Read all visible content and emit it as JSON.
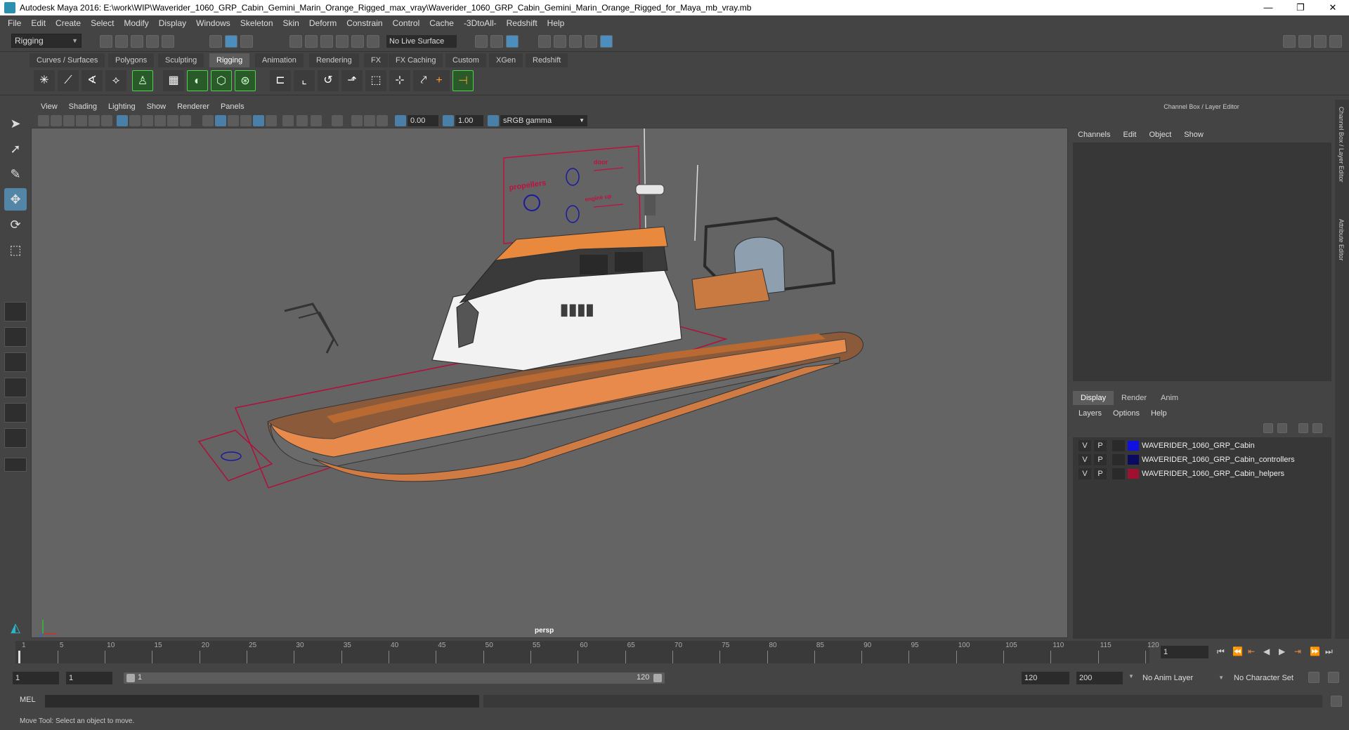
{
  "window": {
    "title": "Autodesk Maya 2016: E:\\work\\WIP\\Waverider_1060_GRP_Cabin_Gemini_Marin_Orange_Rigged_max_vray\\Waverider_1060_GRP_Cabin_Gemini_Marin_Orange_Rigged_for_Maya_mb_vray.mb",
    "minimize": "—",
    "restore": "❐",
    "close": "✕"
  },
  "menubar": [
    "File",
    "Edit",
    "Create",
    "Select",
    "Modify",
    "Display",
    "Windows",
    "Skeleton",
    "Skin",
    "Deform",
    "Constrain",
    "Control",
    "Cache",
    "-3DtoAll-",
    "Redshift",
    "Help"
  ],
  "statusline": {
    "mode": "Rigging",
    "live_surface": "No Live Surface"
  },
  "shelf_tabs": [
    "Curves / Surfaces",
    "Polygons",
    "Sculpting",
    "Rigging",
    "Animation",
    "Rendering",
    "FX",
    "FX Caching",
    "Custom",
    "XGen",
    "Redshift"
  ],
  "shelf_active": "Rigging",
  "viewport": {
    "menu": [
      "View",
      "Shading",
      "Lighting",
      "Show",
      "Renderer",
      "Panels"
    ],
    "exposure": "0.00",
    "gamma": "1.00",
    "color_space": "sRGB gamma",
    "camera": "persp",
    "controller_labels": {
      "propellers": "propellers",
      "door": "door",
      "engine_up": "engine up"
    }
  },
  "channel_box": {
    "header": "Channel Box / Layer Editor",
    "menu": [
      "Channels",
      "Edit",
      "Object",
      "Show"
    ]
  },
  "layer_editor": {
    "tabs": [
      "Display",
      "Render",
      "Anim"
    ],
    "active_tab": "Display",
    "menu": [
      "Layers",
      "Options",
      "Help"
    ],
    "layers": [
      {
        "v": "V",
        "p": "P",
        "name": "WAVERIDER_1060_GRP_Cabin",
        "color": "#1010e0"
      },
      {
        "v": "V",
        "p": "P",
        "name": "WAVERIDER_1060_GRP_Cabin_controllers",
        "color": "#0a0a60"
      },
      {
        "v": "V",
        "p": "P",
        "name": "WAVERIDER_1060_GRP_Cabin_helpers",
        "color": "#a01030"
      }
    ]
  },
  "side_tabs": {
    "channel_box": "Channel Box / Layer Editor",
    "attribute_editor": "Attribute Editor"
  },
  "timeline": {
    "ticks": [
      "1",
      "5",
      "10",
      "15",
      "20",
      "25",
      "30",
      "35",
      "40",
      "45",
      "50",
      "55",
      "60",
      "65",
      "70",
      "75",
      "80",
      "85",
      "90",
      "95",
      "100",
      "105",
      "110",
      "115",
      "120"
    ],
    "current_frame": "1"
  },
  "range": {
    "start": "1",
    "playback_start": "1",
    "slider_start": "1",
    "slider_end": "120",
    "playback_end": "120",
    "end": "200",
    "anim_layer": "No Anim Layer",
    "character_set": "No Character Set"
  },
  "command_line": {
    "language": "MEL"
  },
  "help_line": "Move Tool: Select an object to move."
}
